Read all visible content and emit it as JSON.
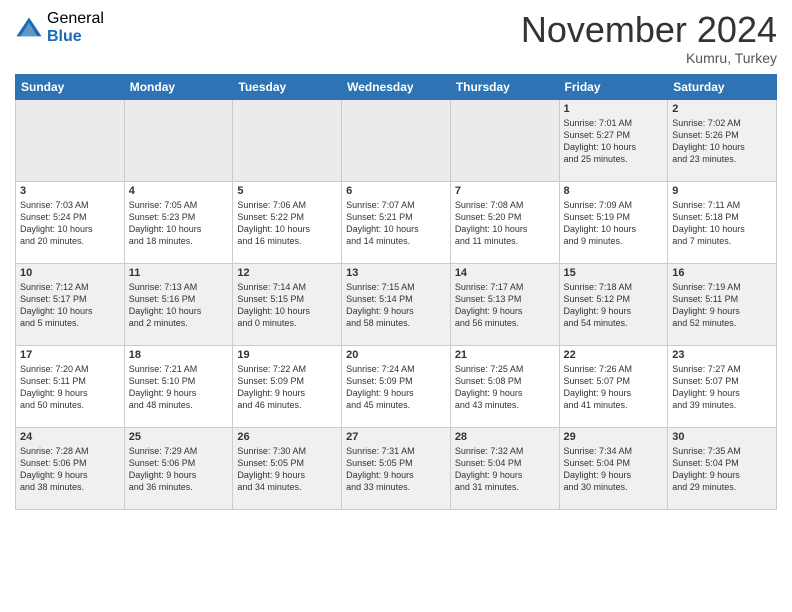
{
  "header": {
    "logo_general": "General",
    "logo_blue": "Blue",
    "month": "November 2024",
    "location": "Kumru, Turkey"
  },
  "weekdays": [
    "Sunday",
    "Monday",
    "Tuesday",
    "Wednesday",
    "Thursday",
    "Friday",
    "Saturday"
  ],
  "weeks": [
    [
      {
        "day": "",
        "info": ""
      },
      {
        "day": "",
        "info": ""
      },
      {
        "day": "",
        "info": ""
      },
      {
        "day": "",
        "info": ""
      },
      {
        "day": "",
        "info": ""
      },
      {
        "day": "1",
        "info": "Sunrise: 7:01 AM\nSunset: 5:27 PM\nDaylight: 10 hours\nand 25 minutes."
      },
      {
        "day": "2",
        "info": "Sunrise: 7:02 AM\nSunset: 5:26 PM\nDaylight: 10 hours\nand 23 minutes."
      }
    ],
    [
      {
        "day": "3",
        "info": "Sunrise: 7:03 AM\nSunset: 5:24 PM\nDaylight: 10 hours\nand 20 minutes."
      },
      {
        "day": "4",
        "info": "Sunrise: 7:05 AM\nSunset: 5:23 PM\nDaylight: 10 hours\nand 18 minutes."
      },
      {
        "day": "5",
        "info": "Sunrise: 7:06 AM\nSunset: 5:22 PM\nDaylight: 10 hours\nand 16 minutes."
      },
      {
        "day": "6",
        "info": "Sunrise: 7:07 AM\nSunset: 5:21 PM\nDaylight: 10 hours\nand 14 minutes."
      },
      {
        "day": "7",
        "info": "Sunrise: 7:08 AM\nSunset: 5:20 PM\nDaylight: 10 hours\nand 11 minutes."
      },
      {
        "day": "8",
        "info": "Sunrise: 7:09 AM\nSunset: 5:19 PM\nDaylight: 10 hours\nand 9 minutes."
      },
      {
        "day": "9",
        "info": "Sunrise: 7:11 AM\nSunset: 5:18 PM\nDaylight: 10 hours\nand 7 minutes."
      }
    ],
    [
      {
        "day": "10",
        "info": "Sunrise: 7:12 AM\nSunset: 5:17 PM\nDaylight: 10 hours\nand 5 minutes."
      },
      {
        "day": "11",
        "info": "Sunrise: 7:13 AM\nSunset: 5:16 PM\nDaylight: 10 hours\nand 2 minutes."
      },
      {
        "day": "12",
        "info": "Sunrise: 7:14 AM\nSunset: 5:15 PM\nDaylight: 10 hours\nand 0 minutes."
      },
      {
        "day": "13",
        "info": "Sunrise: 7:15 AM\nSunset: 5:14 PM\nDaylight: 9 hours\nand 58 minutes."
      },
      {
        "day": "14",
        "info": "Sunrise: 7:17 AM\nSunset: 5:13 PM\nDaylight: 9 hours\nand 56 minutes."
      },
      {
        "day": "15",
        "info": "Sunrise: 7:18 AM\nSunset: 5:12 PM\nDaylight: 9 hours\nand 54 minutes."
      },
      {
        "day": "16",
        "info": "Sunrise: 7:19 AM\nSunset: 5:11 PM\nDaylight: 9 hours\nand 52 minutes."
      }
    ],
    [
      {
        "day": "17",
        "info": "Sunrise: 7:20 AM\nSunset: 5:11 PM\nDaylight: 9 hours\nand 50 minutes."
      },
      {
        "day": "18",
        "info": "Sunrise: 7:21 AM\nSunset: 5:10 PM\nDaylight: 9 hours\nand 48 minutes."
      },
      {
        "day": "19",
        "info": "Sunrise: 7:22 AM\nSunset: 5:09 PM\nDaylight: 9 hours\nand 46 minutes."
      },
      {
        "day": "20",
        "info": "Sunrise: 7:24 AM\nSunset: 5:09 PM\nDaylight: 9 hours\nand 45 minutes."
      },
      {
        "day": "21",
        "info": "Sunrise: 7:25 AM\nSunset: 5:08 PM\nDaylight: 9 hours\nand 43 minutes."
      },
      {
        "day": "22",
        "info": "Sunrise: 7:26 AM\nSunset: 5:07 PM\nDaylight: 9 hours\nand 41 minutes."
      },
      {
        "day": "23",
        "info": "Sunrise: 7:27 AM\nSunset: 5:07 PM\nDaylight: 9 hours\nand 39 minutes."
      }
    ],
    [
      {
        "day": "24",
        "info": "Sunrise: 7:28 AM\nSunset: 5:06 PM\nDaylight: 9 hours\nand 38 minutes."
      },
      {
        "day": "25",
        "info": "Sunrise: 7:29 AM\nSunset: 5:06 PM\nDaylight: 9 hours\nand 36 minutes."
      },
      {
        "day": "26",
        "info": "Sunrise: 7:30 AM\nSunset: 5:05 PM\nDaylight: 9 hours\nand 34 minutes."
      },
      {
        "day": "27",
        "info": "Sunrise: 7:31 AM\nSunset: 5:05 PM\nDaylight: 9 hours\nand 33 minutes."
      },
      {
        "day": "28",
        "info": "Sunrise: 7:32 AM\nSunset: 5:04 PM\nDaylight: 9 hours\nand 31 minutes."
      },
      {
        "day": "29",
        "info": "Sunrise: 7:34 AM\nSunset: 5:04 PM\nDaylight: 9 hours\nand 30 minutes."
      },
      {
        "day": "30",
        "info": "Sunrise: 7:35 AM\nSunset: 5:04 PM\nDaylight: 9 hours\nand 29 minutes."
      }
    ]
  ]
}
